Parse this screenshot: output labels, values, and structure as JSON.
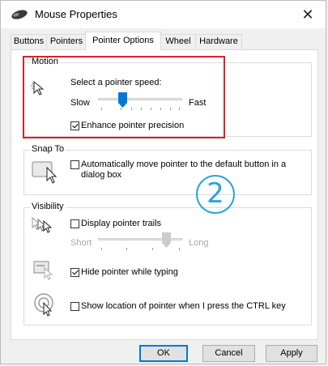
{
  "window": {
    "title": "Mouse Properties",
    "close_glyph": "✕"
  },
  "tabs": [
    {
      "label": "Buttons"
    },
    {
      "label": "Pointers"
    },
    {
      "label": "Pointer Options",
      "active": true
    },
    {
      "label": "Wheel"
    },
    {
      "label": "Hardware"
    }
  ],
  "motion": {
    "group_label": "Motion",
    "speed_label": "Select a pointer speed:",
    "slow_label": "Slow",
    "fast_label": "Fast",
    "speed_level": 0.27,
    "enhance_label": "Enhance pointer precision",
    "enhance_checked": true
  },
  "snap_to": {
    "group_label": "Snap To",
    "auto_move_line1": "Automatically move pointer to the default button in a",
    "auto_move_line2": "dialog box",
    "auto_move_checked": false
  },
  "visibility": {
    "group_label": "Visibility",
    "trails_label": "Display pointer trails",
    "trails_checked": false,
    "short_label": "Short",
    "long_label": "Long",
    "trail_level": 0.85,
    "hide_typing_label": "Hide pointer while typing",
    "hide_typing_checked": true,
    "show_location_label": "Show location of pointer when I press the CTRL key",
    "show_location_checked": false
  },
  "annotation": {
    "step_number": "2",
    "highlight_color": "#d8232a",
    "circle_color": "#2aa3dd"
  },
  "buttons": {
    "ok": "OK",
    "cancel": "Cancel",
    "apply": "Apply"
  },
  "icons": [
    "mouse-icon",
    "pointer-speed-icon",
    "snap-to-icon",
    "pointer-trails-icon",
    "hide-pointer-icon",
    "show-location-icon"
  ]
}
